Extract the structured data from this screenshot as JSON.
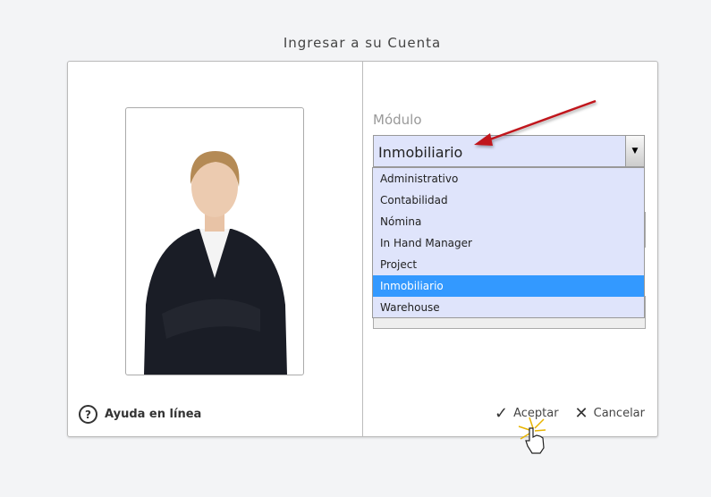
{
  "title": "Ingresar a su Cuenta",
  "help_label": "Ayuda en línea",
  "module_label": "Módulo",
  "module_selected": "Inmobiliario",
  "module_options": [
    "Administrativo",
    "Contabilidad",
    "Nómina",
    "In Hand Manager",
    "Project",
    "Inmobiliario",
    "Warehouse"
  ],
  "accept_label": "Aceptar",
  "cancel_label": "Cancelar",
  "colors": {
    "dropdown_bg": "#dfe4fb",
    "highlight": "#3399ff",
    "arrow": "#c0141b"
  }
}
